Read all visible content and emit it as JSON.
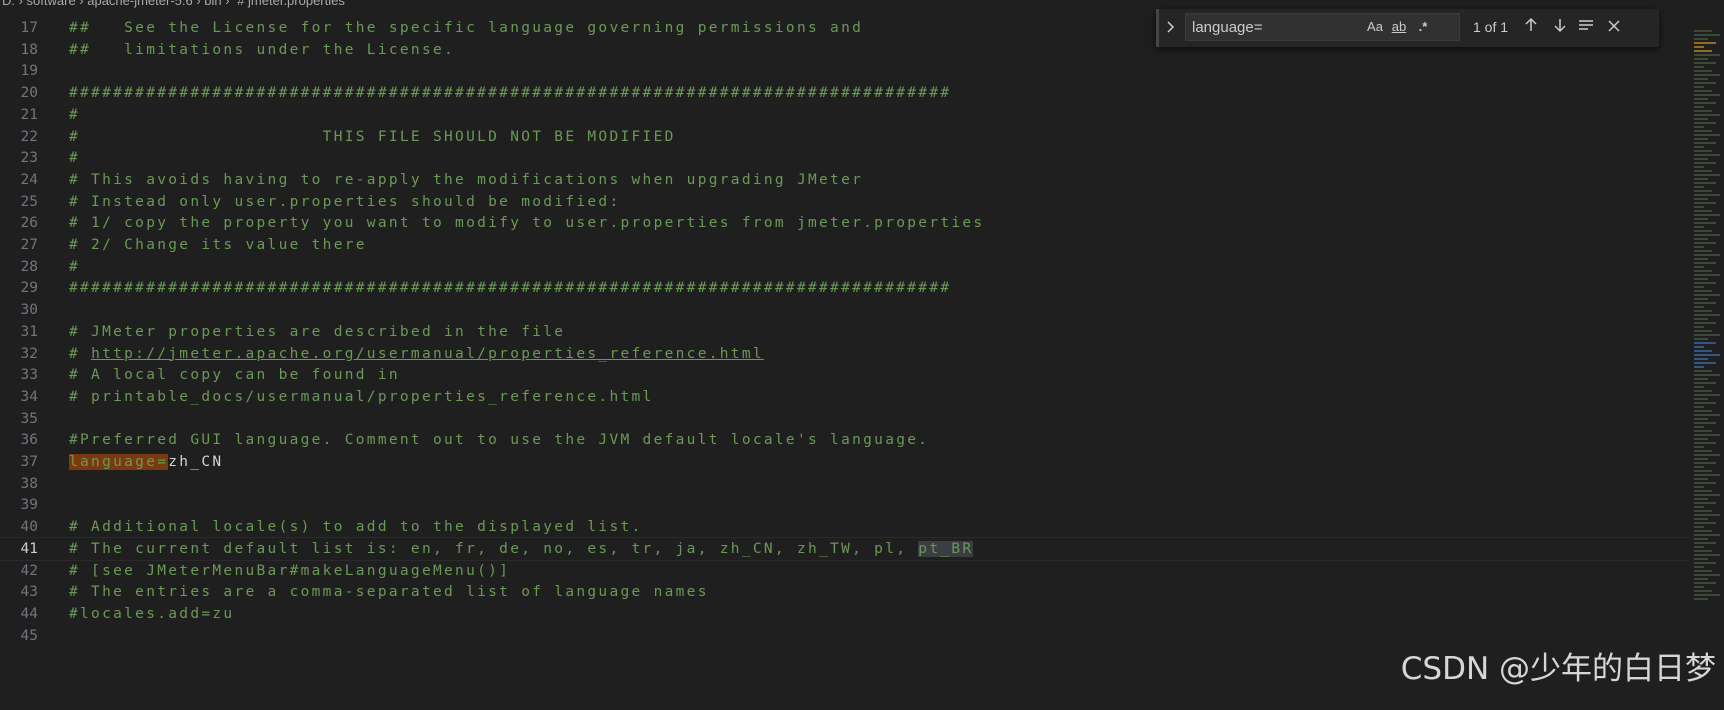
{
  "breadcrumb": [
    "D: › software › apache-jmeter-5.6 › bin › ",
    "# jmeter.properties"
  ],
  "find": {
    "query": "language=",
    "match_case_label": "Aa",
    "whole_word_label": "ab",
    "regex_label": ".*",
    "count": "1 of 1",
    "prev_icon": "arrow-up-icon",
    "next_icon": "arrow-down-icon",
    "selection_icon": "find-in-selection-icon",
    "close_icon": "close-icon"
  },
  "editor": {
    "lines": [
      {
        "n": "17",
        "segments": [
          {
            "t": "##   See the License for the specific language governing permissions and"
          }
        ]
      },
      {
        "n": "18",
        "segments": [
          {
            "t": "##   limitations under the License."
          }
        ]
      },
      {
        "n": "19",
        "segments": [
          {
            "t": ""
          }
        ]
      },
      {
        "n": "20",
        "segments": [
          {
            "t": "################################################################################"
          }
        ]
      },
      {
        "n": "21",
        "segments": [
          {
            "t": "#"
          }
        ]
      },
      {
        "n": "22",
        "segments": [
          {
            "t": "#                      THIS FILE SHOULD NOT BE MODIFIED"
          }
        ]
      },
      {
        "n": "23",
        "segments": [
          {
            "t": "#"
          }
        ]
      },
      {
        "n": "24",
        "segments": [
          {
            "t": "# This avoids having to re-apply the modifications when upgrading JMeter"
          }
        ]
      },
      {
        "n": "25",
        "segments": [
          {
            "t": "# Instead only user.properties should be modified:"
          }
        ]
      },
      {
        "n": "26",
        "segments": [
          {
            "t": "# 1/ copy the property you want to modify to user.properties from jmeter.properties"
          }
        ]
      },
      {
        "n": "27",
        "segments": [
          {
            "t": "# 2/ Change its value there"
          }
        ]
      },
      {
        "n": "28",
        "segments": [
          {
            "t": "#"
          }
        ]
      },
      {
        "n": "29",
        "segments": [
          {
            "t": "################################################################################"
          }
        ]
      },
      {
        "n": "30",
        "segments": [
          {
            "t": ""
          }
        ]
      },
      {
        "n": "31",
        "segments": [
          {
            "t": "# JMeter properties are described in the file"
          }
        ]
      },
      {
        "n": "32",
        "segments": [
          {
            "t": "# "
          },
          {
            "t": "http://jmeter.apache.org/usermanual/properties_reference.html",
            "cls": "link"
          }
        ]
      },
      {
        "n": "33",
        "segments": [
          {
            "t": "# A local copy can be found in"
          }
        ]
      },
      {
        "n": "34",
        "segments": [
          {
            "t": "# printable_docs/usermanual/properties_reference.html"
          }
        ]
      },
      {
        "n": "35",
        "segments": [
          {
            "t": ""
          }
        ]
      },
      {
        "n": "36",
        "segments": [
          {
            "t": "#Preferred GUI language. Comment out to use the JVM default locale's language."
          }
        ]
      },
      {
        "n": "37",
        "segments": [
          {
            "t": "language=",
            "cls": "match"
          },
          {
            "t": "zh_CN",
            "cls": "kw"
          }
        ]
      },
      {
        "n": "38",
        "segments": [
          {
            "t": ""
          }
        ]
      },
      {
        "n": "39",
        "segments": [
          {
            "t": ""
          }
        ]
      },
      {
        "n": "40",
        "segments": [
          {
            "t": "# Additional locale(s) to add to the displayed list."
          }
        ]
      },
      {
        "n": "41",
        "current": true,
        "segments": [
          {
            "t": "# The current default list is: en, fr, de, no, es, tr, ja, zh_CN, zh_TW, pl, "
          },
          {
            "t": "pt_BR",
            "cls": "sel"
          }
        ]
      },
      {
        "n": "42",
        "segments": [
          {
            "t": "# [see JMeterMenuBar#makeLanguageMenu()]"
          }
        ]
      },
      {
        "n": "43",
        "segments": [
          {
            "t": "# The entries are a comma-separated list of language names"
          }
        ]
      },
      {
        "n": "44",
        "segments": [
          {
            "t": "#locales.add=zu"
          }
        ]
      },
      {
        "n": "45",
        "segments": [
          {
            "t": ""
          }
        ]
      }
    ]
  },
  "watermark": "CSDN @少年的白日梦"
}
